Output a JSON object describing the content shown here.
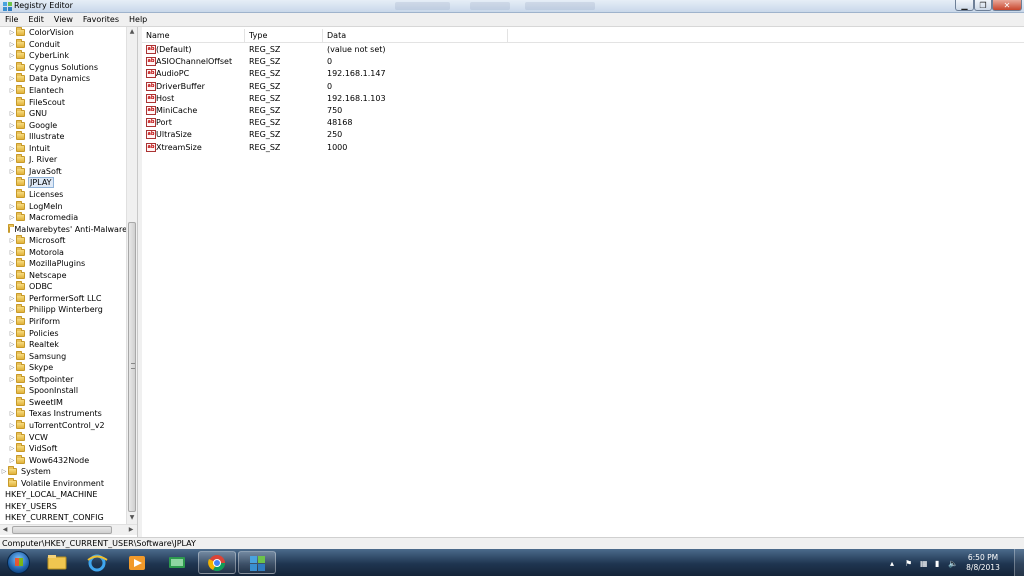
{
  "window": {
    "title": "Registry Editor"
  },
  "menu": [
    "File",
    "Edit",
    "View",
    "Favorites",
    "Help"
  ],
  "tree": {
    "software_children": [
      {
        "label": "ColorVision",
        "expandable": true
      },
      {
        "label": "Conduit",
        "expandable": true
      },
      {
        "label": "CyberLink",
        "expandable": true
      },
      {
        "label": "Cygnus Solutions",
        "expandable": true
      },
      {
        "label": "Data Dynamics",
        "expandable": true
      },
      {
        "label": "Elantech",
        "expandable": true
      },
      {
        "label": "FileScout",
        "expandable": false
      },
      {
        "label": "GNU",
        "expandable": true
      },
      {
        "label": "Google",
        "expandable": true
      },
      {
        "label": "Illustrate",
        "expandable": true
      },
      {
        "label": "Intuit",
        "expandable": true
      },
      {
        "label": "J. River",
        "expandable": true
      },
      {
        "label": "JavaSoft",
        "expandable": true
      },
      {
        "label": "JPLAY",
        "expandable": false,
        "selected": true
      },
      {
        "label": "Licenses",
        "expandable": false
      },
      {
        "label": "LogMeIn",
        "expandable": true
      },
      {
        "label": "Macromedia",
        "expandable": true
      },
      {
        "label": "Malwarebytes' Anti-Malware",
        "expandable": false
      },
      {
        "label": "Microsoft",
        "expandable": true
      },
      {
        "label": "Motorola",
        "expandable": true
      },
      {
        "label": "MozillaPlugins",
        "expandable": true
      },
      {
        "label": "Netscape",
        "expandable": true
      },
      {
        "label": "ODBC",
        "expandable": true
      },
      {
        "label": "PerformerSoft LLC",
        "expandable": true
      },
      {
        "label": "Philipp Winterberg",
        "expandable": true
      },
      {
        "label": "Piriform",
        "expandable": true
      },
      {
        "label": "Policies",
        "expandable": true
      },
      {
        "label": "Realtek",
        "expandable": true
      },
      {
        "label": "Samsung",
        "expandable": true
      },
      {
        "label": "Skype",
        "expandable": true
      },
      {
        "label": "Softpointer",
        "expandable": true
      },
      {
        "label": "SpoonInstall",
        "expandable": false
      },
      {
        "label": "SweetIM",
        "expandable": false
      },
      {
        "label": "Texas Instruments",
        "expandable": true
      },
      {
        "label": "uTorrentControl_v2",
        "expandable": true
      },
      {
        "label": "VCW",
        "expandable": true
      },
      {
        "label": "VidSoft",
        "expandable": true
      },
      {
        "label": "Wow6432Node",
        "expandable": true
      }
    ],
    "user_children": [
      {
        "label": "System",
        "expandable": true
      },
      {
        "label": "Volatile Environment",
        "expandable": false
      }
    ],
    "roots": [
      "HKEY_LOCAL_MACHINE",
      "HKEY_USERS",
      "HKEY_CURRENT_CONFIG"
    ]
  },
  "list": {
    "columns": [
      "Name",
      "Type",
      "Data"
    ],
    "rows": [
      {
        "name": "(Default)",
        "type": "REG_SZ",
        "data": "(value not set)"
      },
      {
        "name": "ASIOChannelOffset",
        "type": "REG_SZ",
        "data": "0"
      },
      {
        "name": "AudioPC",
        "type": "REG_SZ",
        "data": "192.168.1.147"
      },
      {
        "name": "DriverBuffer",
        "type": "REG_SZ",
        "data": "0"
      },
      {
        "name": "Host",
        "type": "REG_SZ",
        "data": "192.168.1.103"
      },
      {
        "name": "MiniCache",
        "type": "REG_SZ",
        "data": "750"
      },
      {
        "name": "Port",
        "type": "REG_SZ",
        "data": "48168"
      },
      {
        "name": "UltraSize",
        "type": "REG_SZ",
        "data": "250"
      },
      {
        "name": "XtreamSize",
        "type": "REG_SZ",
        "data": "1000"
      }
    ],
    "value_icon": "ab"
  },
  "status": {
    "path": "Computer\\HKEY_CURRENT_USER\\Software\\JPLAY"
  },
  "taskbar": {
    "pinned": [
      "windows-explorer-icon",
      "internet-explorer-icon",
      "media-player-icon",
      "media-center-icon",
      "chrome-icon",
      "regedit-icon"
    ],
    "clock_time": "6:50 PM",
    "clock_date": "8/8/2013"
  },
  "colors": {
    "selection": "#dfe9f6",
    "selection_border": "#8fb2d8",
    "taskbar": "#1f3550"
  }
}
